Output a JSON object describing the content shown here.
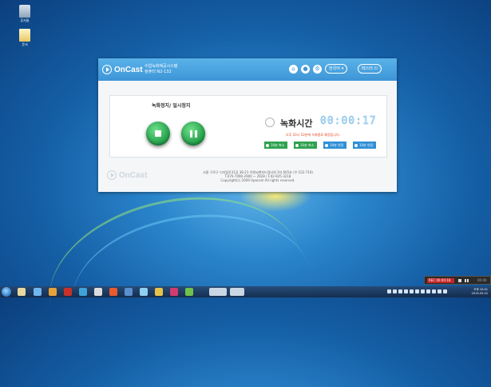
{
  "desktop": {
    "icons": [
      {
        "name": "recycle-bin",
        "label": "휴지통"
      },
      {
        "name": "document",
        "label": "문서"
      }
    ]
  },
  "app": {
    "logo_text": "OnCast",
    "subtitle_line1": "수업녹화제공시스템",
    "subtitle_line2": "컴퓨터 N2-132",
    "header_buttons": [
      {
        "name": "home-icon",
        "glyph": "⌂"
      },
      {
        "name": "user-icon",
        "glyph": "●"
      },
      {
        "name": "settings-icon",
        "glyph": "⚙"
      }
    ],
    "language_select": {
      "value": "한국어"
    },
    "user_pill": {
      "label": "테스터",
      "icon": "power-icon"
    },
    "panel_title": "녹화정지/ 일시정지",
    "rec_time_label": "녹화시간",
    "timer": "00:00:17",
    "notice": "오후 10시 52분에 녹화종료 예정입니다.",
    "options": [
      {
        "label": "10분 축소",
        "color": "#2ea24e"
      },
      {
        "label": "10분 축소",
        "color": "#2ea24e"
      },
      {
        "label": "10분 연장",
        "color": "#2e8fd6"
      },
      {
        "label": "10분 연장",
        "color": "#2e8fd6"
      }
    ],
    "footer": {
      "line1": "서울 구로구 디지털로31길 38-21 이앤씨벤처드림타워 3차 605호 (우:152-719)",
      "line2": "T.070-7090-2900 ~ 2928 / F.02-925-3218",
      "line3": "Copyright(c) 2009 Upacom All rights reserved."
    }
  },
  "mini_recorder": {
    "rec_text": "REC 00:00:18",
    "right_text": "00:00"
  },
  "taskbar": {
    "clock_time": "오후 10:41",
    "clock_date": "2019-03-22"
  },
  "colors": {
    "header": "#3d95d7",
    "accent_green": "#2ea24e",
    "accent_blue": "#2e8fd6",
    "notice_red": "#e0431b"
  }
}
